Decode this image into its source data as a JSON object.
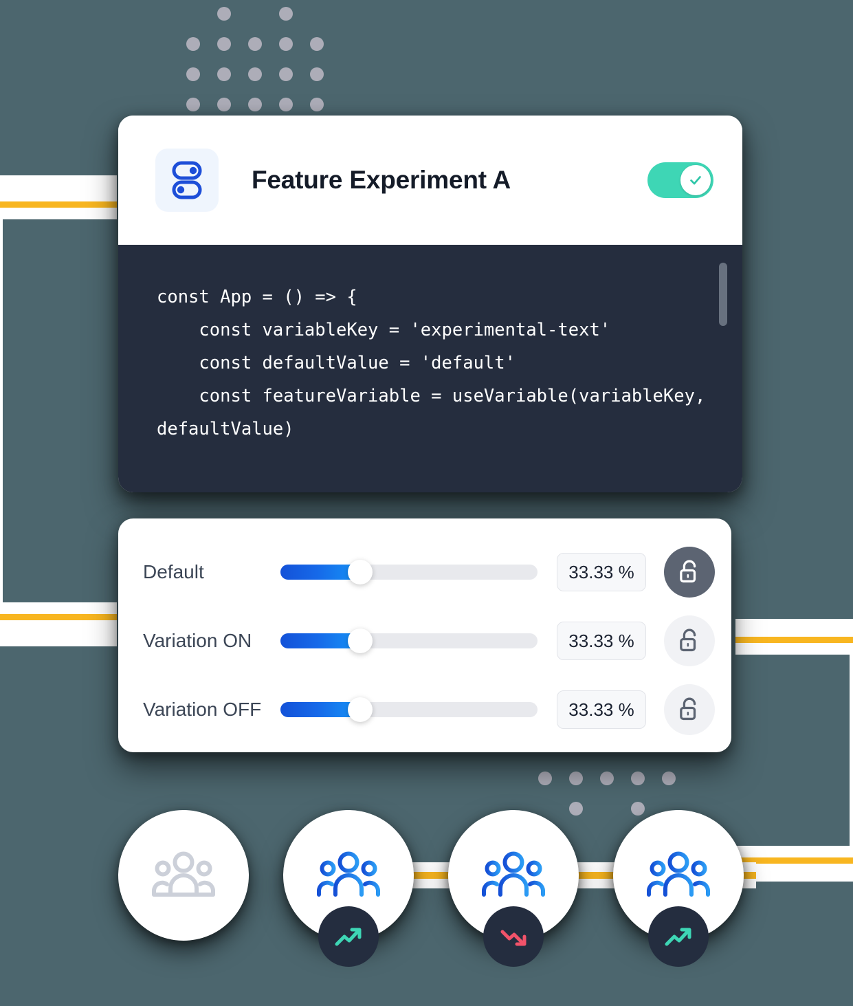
{
  "theme": {
    "background": "#4c666e",
    "accent_yellow": "#f8b620",
    "accent_blue": "#1668e8",
    "accent_teal": "#3ed6b5",
    "accent_red": "#f2536a",
    "code_bg": "#252d3e",
    "card_bg": "#ffffff"
  },
  "header": {
    "icon": "feature-toggle-icon",
    "title": "Feature Experiment A",
    "toggle": {
      "name": "feature-master-toggle",
      "state": "on",
      "knob_icon": "check-icon"
    }
  },
  "code": {
    "language": "javascript",
    "lines": [
      "const App = () => {",
      "    const variableKey = 'experimental-text'",
      "    const defaultValue = 'default'",
      "    const featureVariable = useVariable(variableKey,",
      "defaultValue)"
    ],
    "scrollbar": {
      "visible": true,
      "thumb_position": "top"
    }
  },
  "traffic_allocation": {
    "rows": [
      {
        "label": "Default",
        "percent_text": "33.33 %",
        "percent_value": 33.33,
        "slider_position_pct": 31,
        "lock_icon": "unlock-icon",
        "lock_state": "unlocked",
        "lock_style": "dark"
      },
      {
        "label": "Variation ON",
        "percent_text": "33.33 %",
        "percent_value": 33.33,
        "slider_position_pct": 31,
        "lock_icon": "unlock-icon",
        "lock_state": "unlocked",
        "lock_style": "light"
      },
      {
        "label": "Variation OFF",
        "percent_text": "33.33 %",
        "percent_value": 33.33,
        "slider_position_pct": 31,
        "lock_icon": "unlock-icon",
        "lock_state": "unlocked",
        "lock_style": "light"
      }
    ]
  },
  "audience_segments": [
    {
      "name": "segment-inactive",
      "icon": "people-group-icon",
      "icon_style": "gray",
      "badge": null
    },
    {
      "name": "segment-up-1",
      "icon": "people-group-icon",
      "icon_style": "blue",
      "badge": {
        "icon": "trend-up-icon",
        "color": "#3ed6b5"
      }
    },
    {
      "name": "segment-down",
      "icon": "people-group-icon",
      "icon_style": "blue",
      "badge": {
        "icon": "trend-down-icon",
        "color": "#f2536a"
      }
    },
    {
      "name": "segment-up-2",
      "icon": "people-group-icon",
      "icon_style": "blue",
      "badge": {
        "icon": "trend-up-icon",
        "color": "#3ed6b5"
      }
    }
  ],
  "decor": {
    "dot_grid_top": {
      "columns": 5,
      "rows": 4,
      "filled_first_row": [
        2,
        4
      ]
    },
    "dot_grid_bottom": {
      "columns": 5,
      "rows": 2,
      "filled_second_row": [
        2,
        4
      ]
    },
    "brackets": [
      "left-bracket",
      "right-bracket"
    ],
    "rails": [
      "rail-a",
      "rail-b",
      "rail-c"
    ]
  }
}
